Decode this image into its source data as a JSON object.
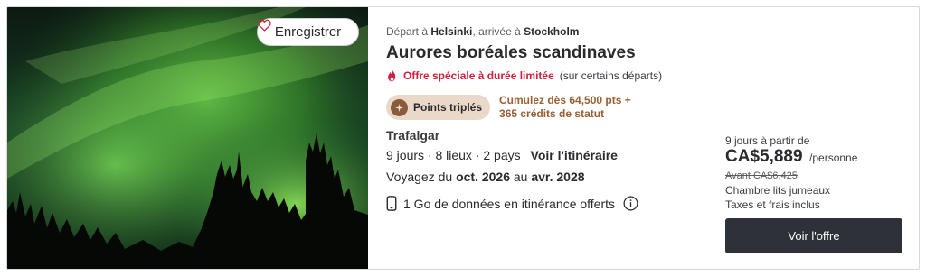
{
  "photo": {
    "alt": "Aurores boréales au-dessus d'une forêt",
    "save_label": "Enregistrer"
  },
  "trip": {
    "route_prefix": "Départ à",
    "route_from": "Helsinki",
    "route_mid": ", arrivée à",
    "route_to": "Stockholm",
    "title": "Aurores boréales scandinaves",
    "offer_label": "Offre spéciale à durée limitée",
    "offer_note": "(sur certains départs)",
    "points_badge": "Points triplés",
    "points_line1": "Cumulez dès 64,500 pts +",
    "points_line2": "365 crédits de statut",
    "brand": "Trafalgar",
    "specs": "9 jours · 8 lieux · 2 pays",
    "itinerary_link": "Voir l'itinéraire",
    "dates_prefix": "Voyagez du",
    "date_start": "oct. 2026",
    "dates_mid": "au",
    "date_end": "avr. 2028",
    "roaming": "1 Go de données en itinérance offerts"
  },
  "pricing": {
    "duration": "9 jours à partir de",
    "price": "CA$5,889",
    "per": "/personne",
    "was": "Avant CA$6,425",
    "room": "Chambre lits jumeaux",
    "taxes": "Taxes et frais inclus",
    "cta": "Voir l'offre"
  },
  "icons": {
    "heart": "heart-icon",
    "flame": "flame-icon",
    "points": "points-icon",
    "phone": "phone-icon",
    "info": "info-icon"
  },
  "colors": {
    "offer_red": "#d11f3c",
    "points_brown": "#9a6034",
    "badge_bg": "#ead8c8",
    "cta_bg": "#2f3138"
  }
}
